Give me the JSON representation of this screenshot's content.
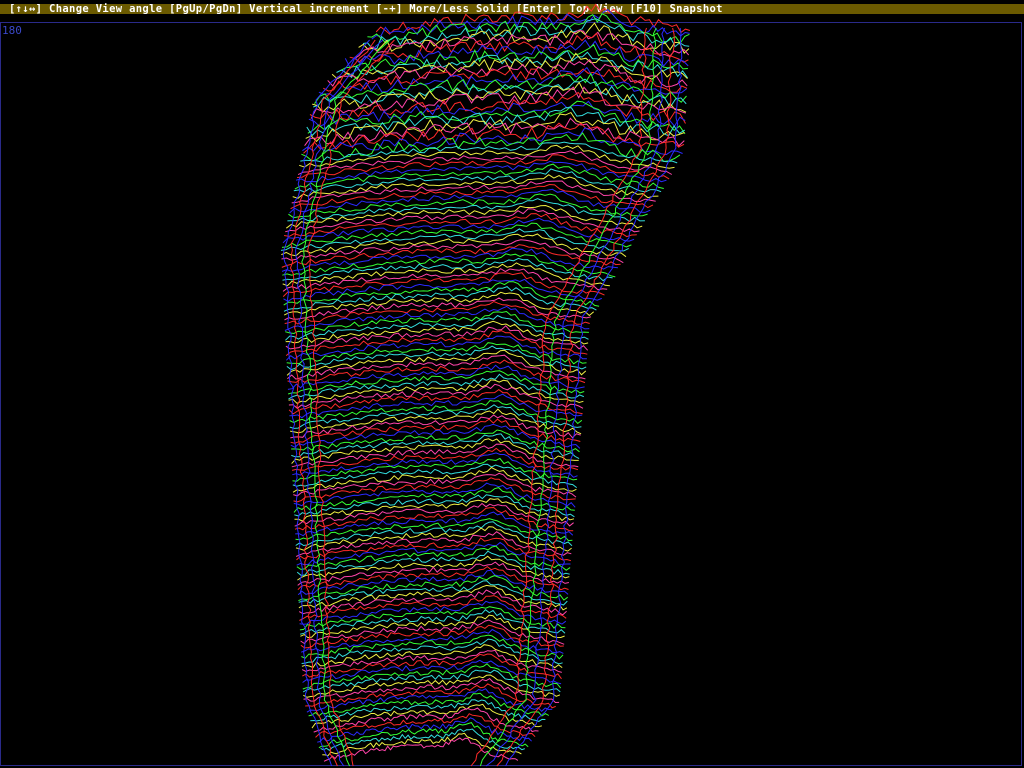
{
  "window": {
    "help_text": "[↑↓↔] Change View angle [PgUp/PgDn] Vertical increment [-+] More/Less Solid [Enter] Top View [F10] Snapshot"
  },
  "plot": {
    "scale_label": "180",
    "line_colors": [
      "#ff2a2a",
      "#2a2aff",
      "#33ff33",
      "#33dddd",
      "#eeee44",
      "#ff44aa"
    ],
    "background": "#000000",
    "help_bar_color": "#6b5a00",
    "frame_color": "#2a2a8a"
  }
}
